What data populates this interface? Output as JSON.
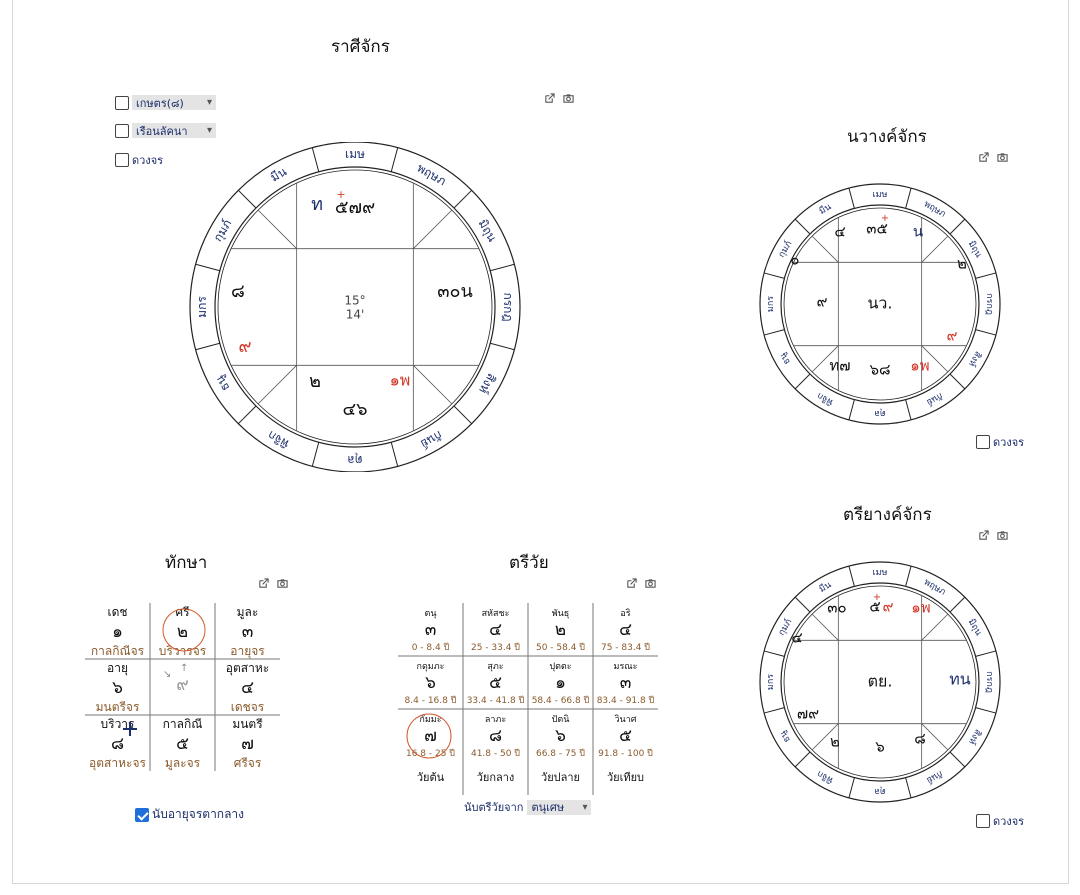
{
  "rasi": {
    "title": "ราศีจักร",
    "checks": [
      {
        "label": "เกษตร(๘)",
        "type": "select"
      },
      {
        "label": "เรือนลัคนา",
        "type": "select"
      },
      {
        "label": "ดวงจร",
        "type": "check"
      }
    ],
    "signs": [
      "เมษ",
      "มีน",
      "กุมภ์",
      "มกร",
      "ธนู",
      "พิจิก",
      "ตุล",
      "กันย์",
      "สิงห์",
      "กรกฎ",
      "มิถุน",
      "พฤษภ"
    ],
    "center_top": "15°",
    "center_bottom": "14'",
    "houses": {
      "top": "๕๗๙",
      "top_prefix": "ท",
      "top_mark": "+",
      "left": "๘",
      "right": "๓๐น",
      "bottom": "๔๖",
      "bl": "๒",
      "br": "๑พ",
      "lb_red": "๙"
    }
  },
  "navang": {
    "title": "นวางค์จักร",
    "check_label": "ดวงจร",
    "signs": [
      "เมษ",
      "มีน",
      "กุมภ์",
      "มกร",
      "ธนู",
      "พิจิก",
      "ตุล",
      "กันย์",
      "สิงห์",
      "กรกฎ",
      "มิถุน",
      "พฤษภ"
    ],
    "center": "นว.",
    "cells": {
      "top": "๓๕",
      "top_mark": "+",
      "tl": "๔",
      "tr": "น",
      "tr2": "๒",
      "l": "๐",
      "l2": "๙",
      "br_red": "๙",
      "bottom": "๖๘",
      "bl": "ท๗",
      "br": "๑พ"
    }
  },
  "triyang": {
    "title": "ตรียางค์จักร",
    "check_label": "ดวงจร",
    "signs": [
      "เมษ",
      "มีน",
      "กุมภ์",
      "มกร",
      "ธนู",
      "พิจิก",
      "ตุล",
      "กันย์",
      "สิงห์",
      "กรกฎ",
      "มิถุน",
      "พฤษภ"
    ],
    "center": "ตย.",
    "cells": {
      "top": "๕",
      "top_red": "๙",
      "top_mark": "+",
      "tl": "๓๐",
      "tr": "๑พ",
      "l1": "๔",
      "r": "ทน",
      "l2": "๗๙",
      "bl": "๒",
      "bottom": "๖",
      "br": "๘"
    }
  },
  "taksa": {
    "title": "ทักษา",
    "cells": [
      {
        "name": "เดช",
        "num": "๑",
        "sub": "กาลกิณีจร"
      },
      {
        "name": "ศรี",
        "num": "๒",
        "sub": "บริวารจร",
        "circled": true
      },
      {
        "name": "มูละ",
        "num": "๓",
        "sub": "อายุจร"
      },
      {
        "name": "อายุ",
        "num": "๖",
        "sub": "มนตรีจร"
      },
      {
        "name": "",
        "num": "๙",
        "sub": "",
        "center": true
      },
      {
        "name": "อุตสาหะ",
        "num": "๔",
        "sub": "เดชจร"
      },
      {
        "name": "บริวาร",
        "num": "๘",
        "sub": "อุตสาหะจร"
      },
      {
        "name": "กาลกิณี",
        "num": "๕",
        "sub": "มูละจร"
      },
      {
        "name": "มนตรี",
        "num": "๗",
        "sub": "ศรีจร"
      }
    ],
    "check_label": "นับอายุจรตากลาง",
    "checked": true
  },
  "triwai": {
    "title": "ตรีวัย",
    "cells": [
      {
        "name": "ตนุ",
        "num": "๓",
        "yr": "0 - 8.4 ปี"
      },
      {
        "name": "สหัสชะ",
        "num": "๔",
        "yr": "25 - 33.4 ปี"
      },
      {
        "name": "พันธุ",
        "num": "๒",
        "yr": "50 - 58.4 ปี"
      },
      {
        "name": "อริ",
        "num": "๔",
        "yr": "75 - 83.4 ปี"
      },
      {
        "name": "กดุมภะ",
        "num": "๖",
        "yr": "8.4 - 16.8 ปี"
      },
      {
        "name": "สุภะ",
        "num": "๕",
        "yr": "33.4 - 41.8 ปี"
      },
      {
        "name": "ปุตตะ",
        "num": "๑",
        "yr": "58.4 - 66.8 ปี"
      },
      {
        "name": "มรณะ",
        "num": "๓",
        "yr": "83.4 - 91.8 ปี"
      },
      {
        "name": "กัมมะ",
        "num": "๗",
        "yr": "16.8 - 25 ปี",
        "circled": true
      },
      {
        "name": "ลาภะ",
        "num": "๘",
        "yr": "41.8 - 50 ปี"
      },
      {
        "name": "ปัตนิ",
        "num": "๖",
        "yr": "66.8 - 75 ปี"
      },
      {
        "name": "วินาศ",
        "num": "๕",
        "yr": "91.8 - 100 ปี"
      }
    ],
    "ages": [
      "วัยต้น",
      "วัยกลาง",
      "วัยปลาย",
      "วัยเทียบ"
    ],
    "count_label": "นับตรีวัยจาก",
    "count_value": "ตนุเศษ"
  },
  "colors": {
    "sign": "#1c2e6b",
    "red": "#d23a2a",
    "planet_blue": "#1c2e6b",
    "brown": "#8a5a2b"
  }
}
